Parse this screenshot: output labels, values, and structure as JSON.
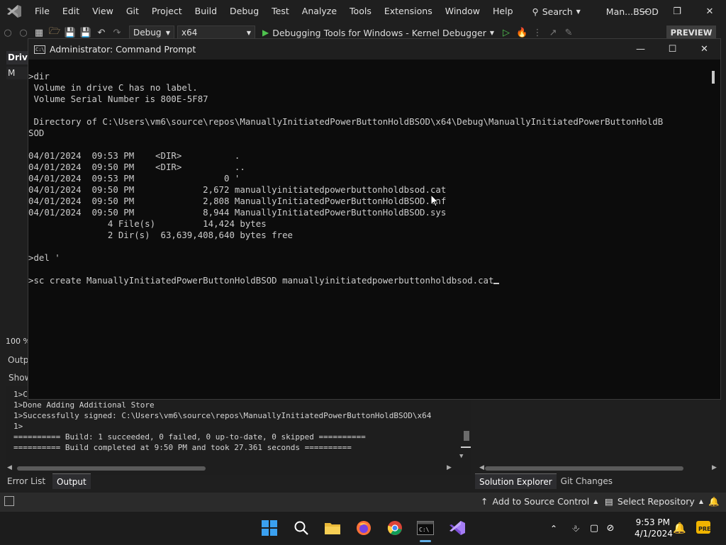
{
  "menubar": {
    "items": [
      "File",
      "Edit",
      "View",
      "Git",
      "Project",
      "Build",
      "Debug",
      "Test",
      "Analyze",
      "Tools",
      "Extensions",
      "Window",
      "Help"
    ],
    "search_label": "Search",
    "solution_name": "Man...BSOD"
  },
  "toolbar": {
    "config": "Debug",
    "platform": "x64",
    "debug_target": "Debugging Tools for Windows - Kernel Debugger",
    "preview_badge": "PREVIEW"
  },
  "left_panel": {
    "tab_label": "Drive",
    "item_label": "M",
    "zoom": "100 %",
    "output_label": "Outp",
    "show_label": "Show"
  },
  "cmd": {
    "title": "Administrator: Command Prompt",
    "lines": [
      ">dir",
      " Volume in drive C has no label.",
      " Volume Serial Number is 800E-5F87",
      "",
      " Directory of C:\\Users\\vm6\\source\\repos\\ManuallyInitiatedPowerButtonHoldBSOD\\x64\\Debug\\ManuallyInitiatedPowerButtonHoldB",
      "SOD",
      "",
      "04/01/2024  09:53 PM    <DIR>          .",
      "04/01/2024  09:50 PM    <DIR>          ..",
      "04/01/2024  09:53 PM                 0 '",
      "04/01/2024  09:50 PM             2,672 manuallyinitiatedpowerbuttonholdbsod.cat",
      "04/01/2024  09:50 PM             2,808 ManuallyInitiatedPowerButtonHoldBSOD.inf",
      "04/01/2024  09:50 PM             8,944 ManuallyInitiatedPowerButtonHoldBSOD.sys",
      "               4 File(s)         14,424 bytes",
      "               2 Dir(s)  63,639,408,640 bytes free",
      "",
      ">del '",
      "",
      ">sc create ManuallyInitiatedPowerButtonHoldBSOD manuallyinitiatedpowerbuttonholdbsod.cat"
    ]
  },
  "output": {
    "lines": [
      "1>C",
      "1>Done Adding Additional Store",
      "1>Successfully signed: C:\\Users\\vm6\\source\\repos\\ManuallyInitiatedPowerButtonHoldBSOD\\x64",
      "1>",
      "========== Build: 1 succeeded, 0 failed, 0 up-to-date, 0 skipped ==========",
      "========== Build completed at 9:50 PM and took 27.361 seconds =========="
    ],
    "tabs": [
      "Error List",
      "Output"
    ],
    "right_tabs": [
      "Solution Explorer",
      "Git Changes"
    ]
  },
  "statusbar": {
    "source_control": "Add to Source Control",
    "repository": "Select Repository"
  },
  "taskbar": {
    "time": "9:53 PM",
    "date": "4/1/2024",
    "apps": [
      "start-icon",
      "search-icon",
      "file-explorer-icon",
      "firefox-icon",
      "chrome-icon",
      "terminal-icon",
      "visual-studio-icon"
    ]
  }
}
